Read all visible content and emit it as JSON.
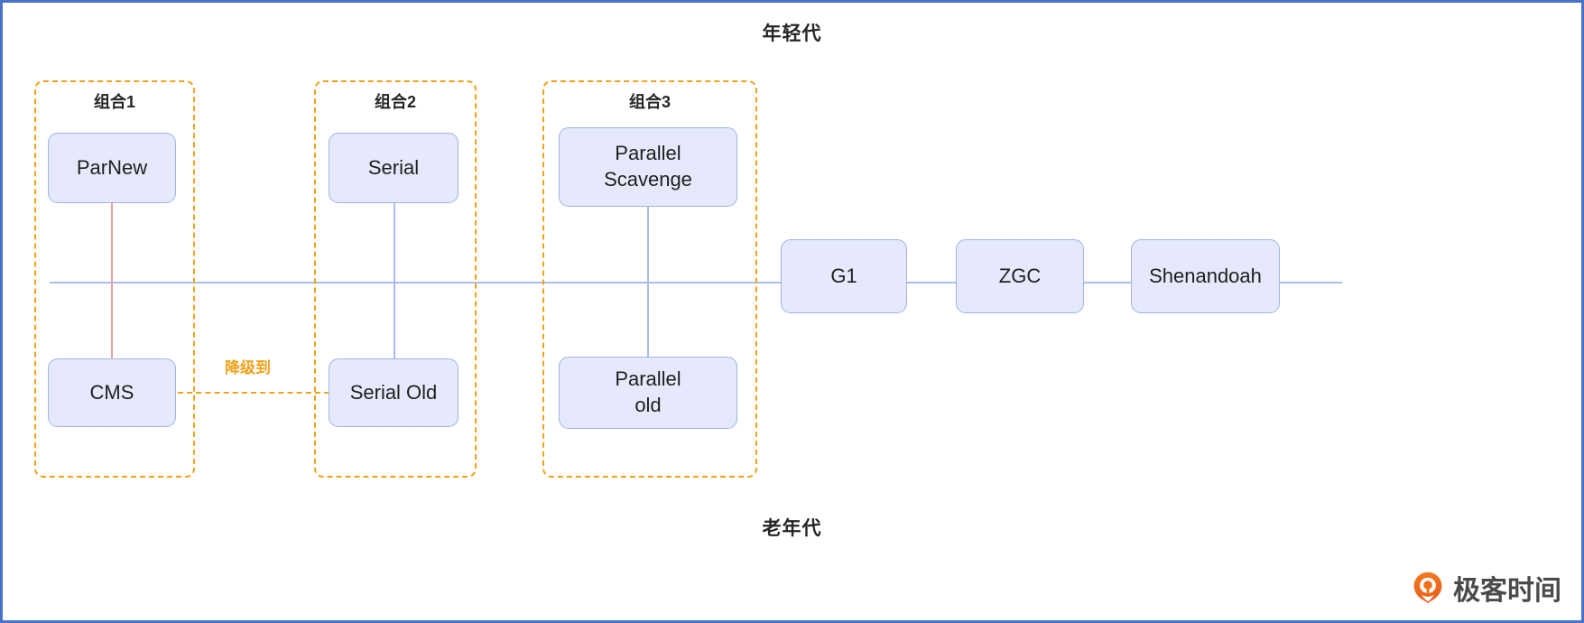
{
  "diagram": {
    "title_top": "年轻代",
    "title_bottom": "老年代",
    "accent_orange": "#f0a21b",
    "node_fill": "#e6e9fb",
    "node_border": "#9fb3e5",
    "frame_border": "#4a72c8"
  },
  "groups": [
    {
      "label": "组合1"
    },
    {
      "label": "组合2"
    },
    {
      "label": "组合3"
    }
  ],
  "nodes": {
    "parnew": "ParNew",
    "cms": "CMS",
    "serial": "Serial",
    "serial_old": "Serial Old",
    "parallel_scavenge": "Parallel\nScavenge",
    "parallel_old": "Parallel\nold",
    "g1": "G1",
    "zgc": "ZGC",
    "shenandoah": "Shenandoah"
  },
  "edges": {
    "degrade_label": "降级到"
  },
  "logo": {
    "text": "极客时间",
    "icon": "geektime-pin-icon"
  }
}
